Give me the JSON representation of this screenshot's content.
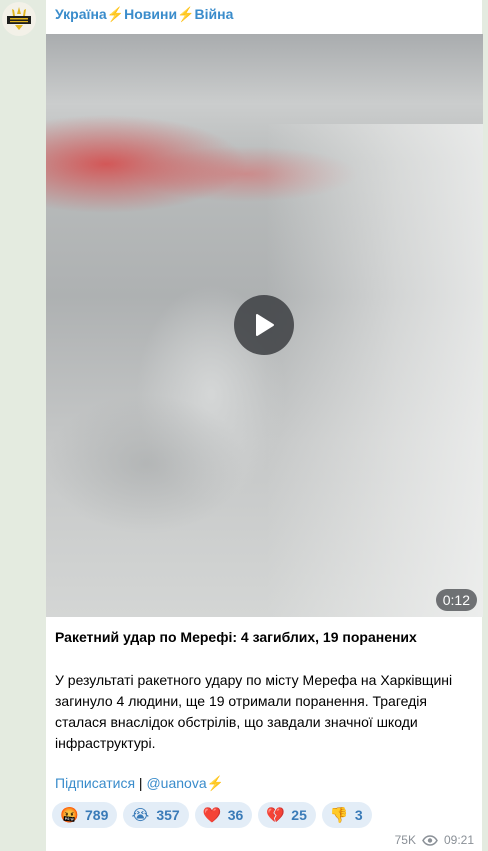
{
  "channel": {
    "name": "Україна⚡️Новини⚡️Війна",
    "avatar_icon": "trident-logo-icon"
  },
  "video": {
    "duration": "0:12",
    "play_icon": "play-icon"
  },
  "post": {
    "title": "Ракетний удар по Мерефі: 4 загиблих, 19 поранених",
    "body": "У результаті ракетного удару по місту Мерефа на Харківщині загинуло 4 людини, ще 19 отримали поранення. Трагедія сталася внаслідок обстрілів, що завдали значної шкоди інфраструктурі.",
    "subscribe_link": "Підписатися",
    "separator": " | ",
    "channel_link": "@uanova⚡️"
  },
  "reactions": [
    {
      "emoji": "🤬",
      "count": "789",
      "icon": "angry-face-icon"
    },
    {
      "emoji": "😭",
      "count": "357",
      "icon": "crying-face-icon"
    },
    {
      "emoji": "❤️",
      "count": "36",
      "icon": "red-heart-icon"
    },
    {
      "emoji": "💔",
      "count": "25",
      "icon": "broken-heart-icon"
    },
    {
      "emoji": "👎",
      "count": "3",
      "icon": "thumbs-down-icon"
    }
  ],
  "meta": {
    "views": "75K",
    "time": "09:21",
    "views_icon": "eye-icon"
  },
  "colors": {
    "link": "#3a8ccb",
    "reaction_bg": "#e3edf7",
    "chat_bg": "#e4ebe0"
  }
}
